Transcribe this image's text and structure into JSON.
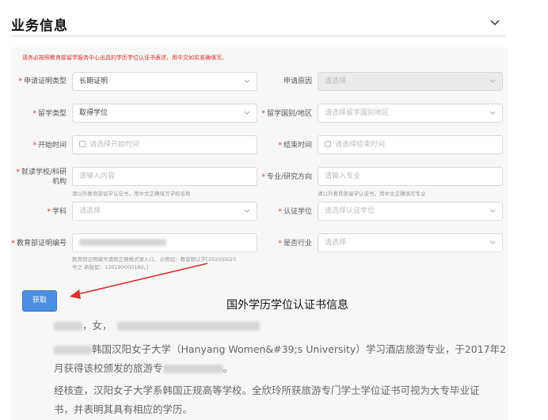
{
  "section": {
    "title": "业务信息"
  },
  "notice": "请务必按照教育部留学服务中心出具的学历学位认证书表述，用中文如实准确填写。",
  "form": {
    "cert_type": {
      "label": "申请证明类型",
      "value": "长期证明"
    },
    "reason": {
      "label": "申请原因",
      "placeholder": "请选择"
    },
    "study_type": {
      "label": "留学类型",
      "value": "取得学位"
    },
    "country": {
      "label": "留学国别/地区",
      "placeholder": "请选择留学国别地区"
    },
    "start_time": {
      "label": "开始时间",
      "placeholder": "请选择开始时间"
    },
    "end_time": {
      "label": "结束时间",
      "placeholder": "请选择结束时间"
    },
    "school": {
      "label_line1": "就读学校/科研",
      "label_line2": "机构",
      "placeholder": "请输入内容",
      "hint": "请以外教育部留学认证书，用中文正确填写学校名称"
    },
    "major": {
      "label": "专业/研究方向",
      "placeholder": "请输入专业",
      "hint": "请以外教育部留学认证书，用中文正确填写专业"
    },
    "discipline": {
      "label": "学科",
      "placeholder": "请选择"
    },
    "degree": {
      "label": "认证学位",
      "placeholder": "请选择认证学位"
    },
    "cert_no": {
      "label": "教育部证明编号",
      "hint_line1": "教育部证明编号请按正确格式录入(1、示例如：教留服认字[2020]0025",
      "hint_line2": "号之 新版如：120190000180。)"
    },
    "industry": {
      "label": "是否行业",
      "placeholder": "请选择"
    }
  },
  "button": {
    "label": "获取"
  },
  "annotation": "国外学历学位认证书信息",
  "certificate": {
    "line1": "，女，",
    "line2": "韩国汉阳女子大学（Hanyang Women&#39;s University）学习酒店旅游专业，于2017年2",
    "line3a": "月获得该校颁发的旅游专",
    "line3b": "。",
    "line4": "经核查，汉阳女子大学系韩国正规高等学校。全欣玲所获旅游专门学士学位证书可视为大专毕业证",
    "line5": "书，并表明其具有相应的学历。"
  },
  "colors": {
    "accent": "#4a90e2",
    "required": "#d9302c",
    "annotation_arrow": "#d9302c"
  }
}
